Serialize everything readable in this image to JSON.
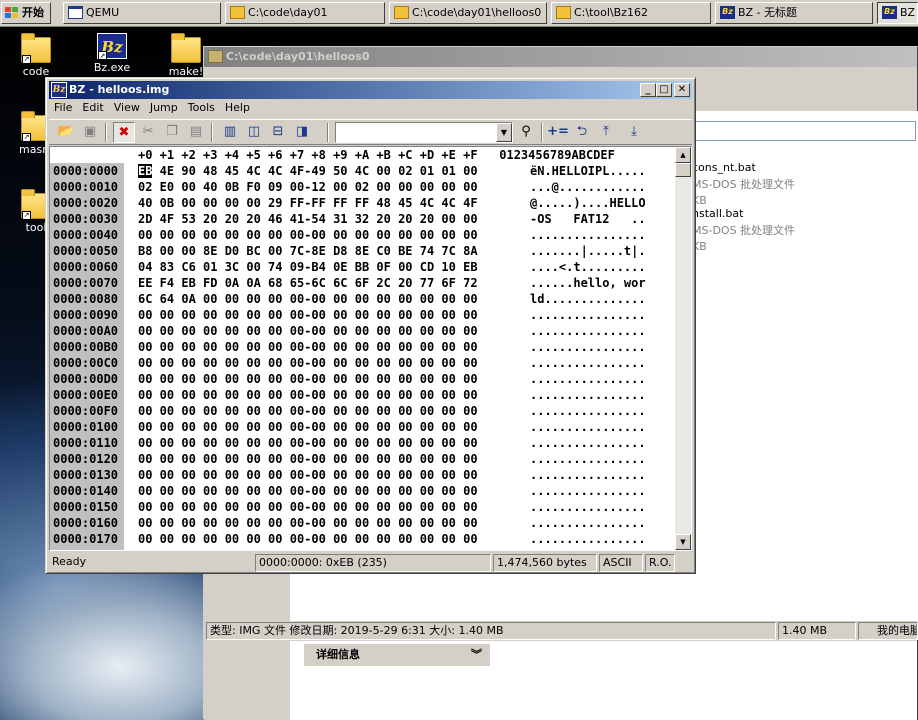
{
  "taskbar": {
    "start_label": "开始",
    "tasks": [
      {
        "label": "QEMU"
      },
      {
        "label": "C:\\code\\day01"
      },
      {
        "label": "C:\\code\\day01\\helloos0"
      },
      {
        "label": "C:\\tool\\Bz162"
      },
      {
        "label": "BZ - 无标题"
      },
      {
        "label": "BZ"
      }
    ]
  },
  "desktop": {
    "icons": [
      {
        "label": "code"
      },
      {
        "label": "Bz.exe"
      },
      {
        "label": "make!"
      },
      {
        "label": "masm"
      },
      {
        "label": "tool"
      }
    ]
  },
  "explorer": {
    "title": "C:\\code\\day01\\helloos0",
    "files": [
      {
        "name": "cons_nt.bat",
        "type": "MS-DOS 批处理文件",
        "size": "KB"
      },
      {
        "name": "nstall.bat",
        "type": "MS-DOS 批处理文件",
        "size": "KB"
      }
    ],
    "status": {
      "info": "类型: IMG 文件 修改日期: 2019-5-29 6:31 大小: 1.40 MB",
      "size": "1.40 MB",
      "location": "我的电脑"
    },
    "details_label": "详细信息"
  },
  "bz": {
    "title": "BZ - helloos.img",
    "menu": [
      "File",
      "Edit",
      "View",
      "Jump",
      "Tools",
      "Help"
    ],
    "hex_header": "+0 +1 +2 +3 +4 +5 +6 +7 +8 +9 +A +B +C +D +E +F",
    "ascii_header": "0123456789ABCDEF",
    "cursor_byte": "EB",
    "rows": [
      {
        "offset": "0000:0000",
        "hex_rest": " 4E 90 48 45 4C 4C 4F-49 50 4C 00 02 01 01 00",
        "ascii": "ëN.HELLOIPL....."
      },
      {
        "offset": "0000:0010",
        "hex": "02 E0 00 40 0B F0 09 00-12 00 02 00 00 00 00 00",
        "ascii": "...@............"
      },
      {
        "offset": "0000:0020",
        "hex": "40 0B 00 00 00 00 29 FF-FF FF FF 48 45 4C 4C 4F",
        "ascii": "@.....)....HELLO"
      },
      {
        "offset": "0000:0030",
        "hex": "2D 4F 53 20 20 20 46 41-54 31 32 20 20 20 00 00",
        "ascii": "-OS   FAT12   .."
      },
      {
        "offset": "0000:0040",
        "hex": "00 00 00 00 00 00 00 00-00 00 00 00 00 00 00 00",
        "ascii": "................"
      },
      {
        "offset": "0000:0050",
        "hex": "B8 00 00 8E D0 BC 00 7C-8E D8 8E C0 BE 74 7C 8A",
        "ascii": ".......|.....t|."
      },
      {
        "offset": "0000:0060",
        "hex": "04 83 C6 01 3C 00 74 09-B4 0E BB 0F 00 CD 10 EB",
        "ascii": "....<.t........."
      },
      {
        "offset": "0000:0070",
        "hex": "EE F4 EB FD 0A 0A 68 65-6C 6C 6F 2C 20 77 6F 72",
        "ascii": "......hello, wor"
      },
      {
        "offset": "0000:0080",
        "hex": "6C 64 0A 00 00 00 00 00-00 00 00 00 00 00 00 00",
        "ascii": "ld.............."
      },
      {
        "offset": "0000:0090",
        "hex": "00 00 00 00 00 00 00 00-00 00 00 00 00 00 00 00",
        "ascii": "................"
      },
      {
        "offset": "0000:00A0",
        "hex": "00 00 00 00 00 00 00 00-00 00 00 00 00 00 00 00",
        "ascii": "................"
      },
      {
        "offset": "0000:00B0",
        "hex": "00 00 00 00 00 00 00 00-00 00 00 00 00 00 00 00",
        "ascii": "................"
      },
      {
        "offset": "0000:00C0",
        "hex": "00 00 00 00 00 00 00 00-00 00 00 00 00 00 00 00",
        "ascii": "................"
      },
      {
        "offset": "0000:00D0",
        "hex": "00 00 00 00 00 00 00 00-00 00 00 00 00 00 00 00",
        "ascii": "................"
      },
      {
        "offset": "0000:00E0",
        "hex": "00 00 00 00 00 00 00 00-00 00 00 00 00 00 00 00",
        "ascii": "................"
      },
      {
        "offset": "0000:00F0",
        "hex": "00 00 00 00 00 00 00 00-00 00 00 00 00 00 00 00",
        "ascii": "................"
      },
      {
        "offset": "0000:0100",
        "hex": "00 00 00 00 00 00 00 00-00 00 00 00 00 00 00 00",
        "ascii": "................"
      },
      {
        "offset": "0000:0110",
        "hex": "00 00 00 00 00 00 00 00-00 00 00 00 00 00 00 00",
        "ascii": "................"
      },
      {
        "offset": "0000:0120",
        "hex": "00 00 00 00 00 00 00 00-00 00 00 00 00 00 00 00",
        "ascii": "................"
      },
      {
        "offset": "0000:0130",
        "hex": "00 00 00 00 00 00 00 00-00 00 00 00 00 00 00 00",
        "ascii": "................"
      },
      {
        "offset": "0000:0140",
        "hex": "00 00 00 00 00 00 00 00-00 00 00 00 00 00 00 00",
        "ascii": "................"
      },
      {
        "offset": "0000:0150",
        "hex": "00 00 00 00 00 00 00 00-00 00 00 00 00 00 00 00",
        "ascii": "................"
      },
      {
        "offset": "0000:0160",
        "hex": "00 00 00 00 00 00 00 00-00 00 00 00 00 00 00 00",
        "ascii": "................"
      },
      {
        "offset": "0000:0170",
        "hex": "00 00 00 00 00 00 00 00-00 00 00 00 00 00 00 00",
        "ascii": "................"
      }
    ],
    "status": {
      "ready": "Ready",
      "position": "0000:0000: 0xEB (235)",
      "size": "1,474,560 bytes",
      "encoding": "ASCII",
      "mode": "R.O."
    }
  }
}
